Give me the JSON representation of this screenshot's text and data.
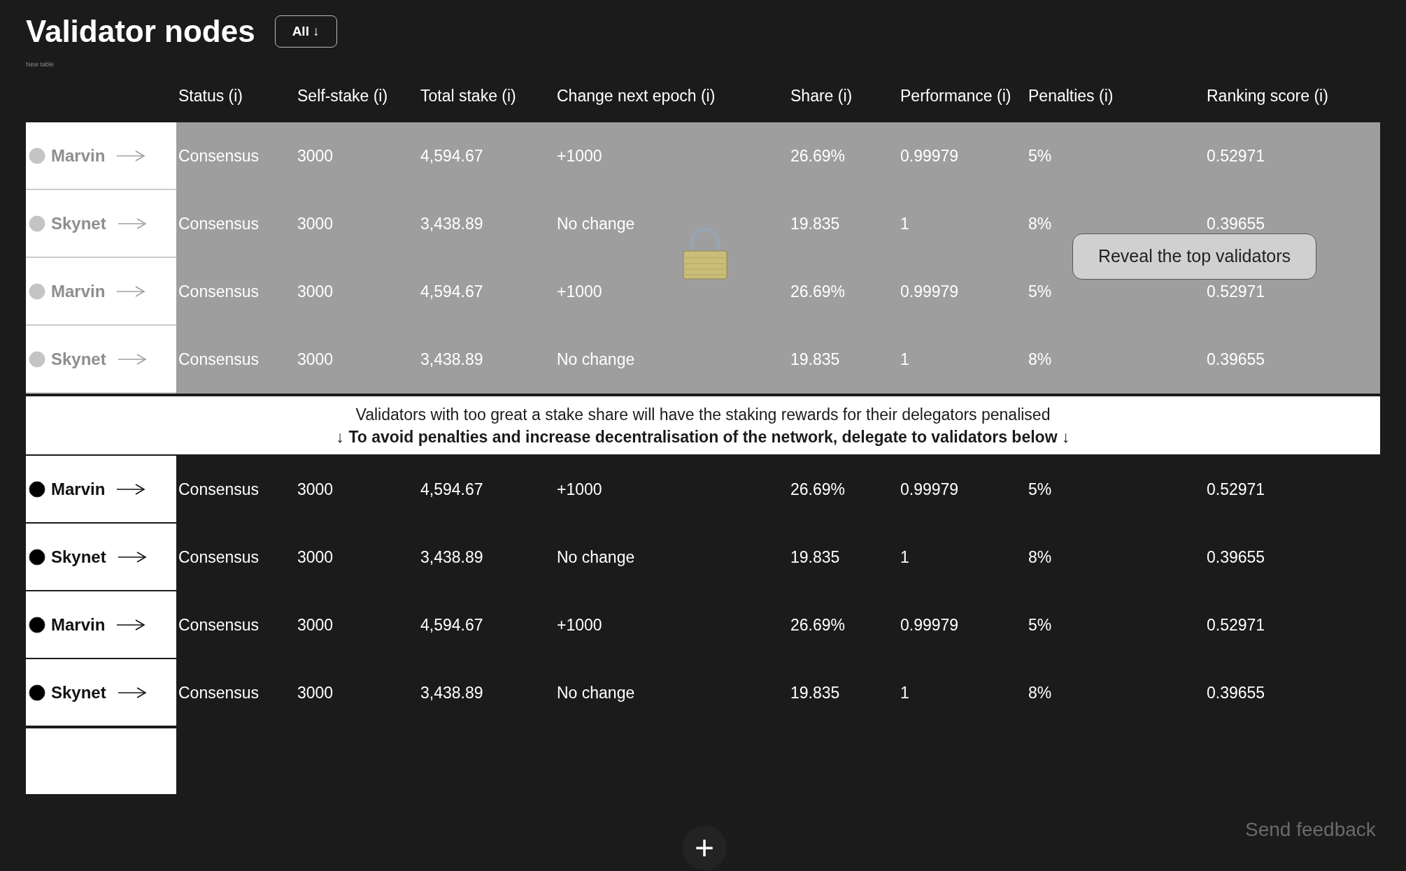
{
  "title": "Validator nodes",
  "filter_button": "All ↓",
  "caption": "New table",
  "columns": [
    "Status (i)",
    "Self-stake (i)",
    "Total stake (i)",
    "Change next epoch (i)",
    "Share (i)",
    "Performance (i)",
    "Penalties (i)",
    "Ranking score (i)"
  ],
  "locked_section": {
    "locked": true,
    "reveal_button": "Reveal the top validators",
    "rows": [
      {
        "name": "Marvin",
        "cells": [
          "Consensus",
          "3000",
          "4,594.67",
          "+1000",
          "26.69%",
          "0.99979",
          "5%",
          "0.52971"
        ]
      },
      {
        "name": "Skynet",
        "cells": [
          "Consensus",
          "3000",
          "3,438.89",
          "No change",
          "19.835",
          "1",
          "8%",
          "0.39655"
        ]
      },
      {
        "name": "Marvin",
        "cells": [
          "Consensus",
          "3000",
          "4,594.67",
          "+1000",
          "26.69%",
          "0.99979",
          "5%",
          "0.52971"
        ]
      },
      {
        "name": "Skynet",
        "cells": [
          "Consensus",
          "3000",
          "3,438.89",
          "No change",
          "19.835",
          "1",
          "8%",
          "0.39655"
        ]
      }
    ]
  },
  "notice": {
    "line_1": "Validators with too great a stake share will have the staking rewards for their delegators penalised",
    "line_2": "↓ To avoid penalties and increase decentralisation of the network, delegate to validators below ↓"
  },
  "rows": [
    {
      "name": "Marvin",
      "cells": [
        "Consensus",
        "3000",
        "4,594.67",
        "+1000",
        "26.69%",
        "0.99979",
        "5%",
        "0.52971"
      ]
    },
    {
      "name": "Skynet",
      "cells": [
        "Consensus",
        "3000",
        "3,438.89",
        "No change",
        "19.835",
        "1",
        "8%",
        "0.39655"
      ]
    },
    {
      "name": "Marvin",
      "cells": [
        "Consensus",
        "3000",
        "4,594.67",
        "+1000",
        "26.69%",
        "0.99979",
        "5%",
        "0.52971"
      ]
    },
    {
      "name": "Skynet",
      "cells": [
        "Consensus",
        "3000",
        "3,438.89",
        "No change",
        "19.835",
        "1",
        "8%",
        "0.39655"
      ]
    }
  ],
  "add_button": "+",
  "feedback_link": "Send feedback"
}
